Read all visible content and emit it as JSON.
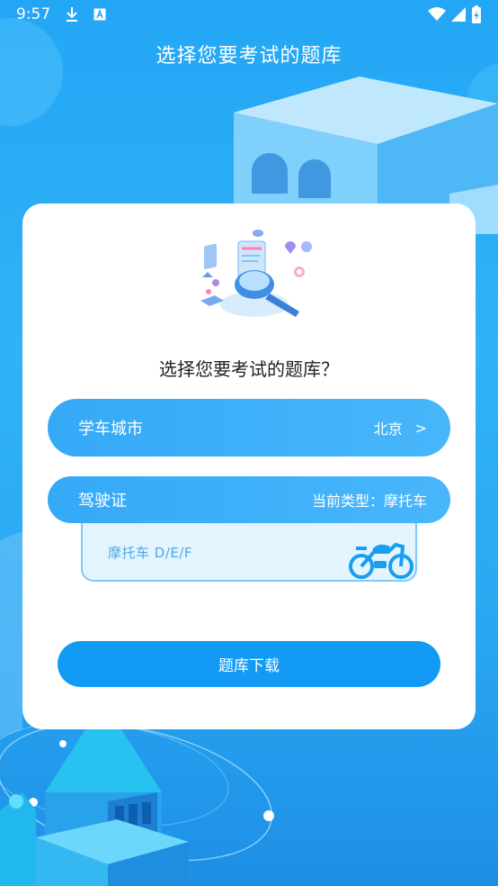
{
  "status_bar": {
    "time": "9:57"
  },
  "header": {
    "title": "选择您要考试的题库"
  },
  "card": {
    "question": "选择您要考试的题库？",
    "city_row": {
      "label": "学车城市",
      "value": "北京",
      "arrow": ">"
    },
    "license_row": {
      "label": "驾驶证",
      "current_type": "当前类型：摩托车"
    },
    "option": {
      "label": "摩托车  D/E/F",
      "icon": "motorcycle-icon"
    },
    "download_button": "题库下载"
  },
  "colors": {
    "primary": "#139af5",
    "pill": "#3aaaf7",
    "option_bg": "#e3f4fe",
    "background": "#2aa7f2"
  }
}
